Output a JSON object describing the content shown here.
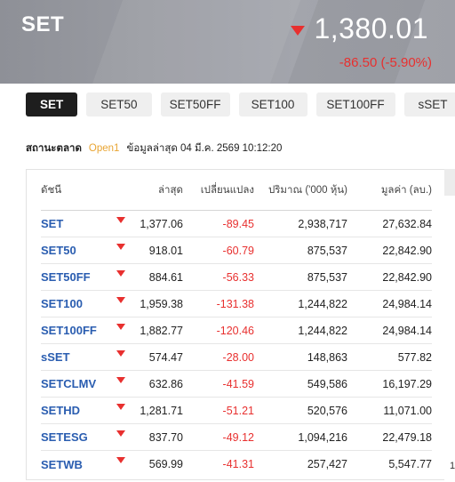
{
  "hero": {
    "title": "SET",
    "price": "1,380.01",
    "change": "-86.50 (-5.90%)",
    "direction_icon": "down-triangle-icon",
    "down_color": "#e8302f"
  },
  "tabs": [
    {
      "label": "SET",
      "active": true
    },
    {
      "label": "SET50",
      "active": false
    },
    {
      "label": "SET50FF",
      "active": false
    },
    {
      "label": "SET100",
      "active": false
    },
    {
      "label": "SET100FF",
      "active": false
    },
    {
      "label": "sSET",
      "active": false
    }
  ],
  "status": {
    "label": "สถานะตลาด",
    "market_state": "Open1",
    "updated": "ข้อมูลล่าสุด 04 มี.ค. 2569 10:12:20"
  },
  "table": {
    "headers": {
      "name": "ดัชนี",
      "last": "ล่าสุด",
      "change": "เปลี่ยนแปลง",
      "volume": "ปริมาณ ('000 หุ้น)",
      "value": "มูลค่า (ลบ.)"
    },
    "rows": [
      {
        "name": "SET",
        "last": "1,377.06",
        "change": "-89.45",
        "volume": "2,938,717",
        "value": "27,632.84"
      },
      {
        "name": "SET50",
        "last": "918.01",
        "change": "-60.79",
        "volume": "875,537",
        "value": "22,842.90"
      },
      {
        "name": "SET50FF",
        "last": "884.61",
        "change": "-56.33",
        "volume": "875,537",
        "value": "22,842.90"
      },
      {
        "name": "SET100",
        "last": "1,959.38",
        "change": "-131.38",
        "volume": "1,244,822",
        "value": "24,984.14"
      },
      {
        "name": "SET100FF",
        "last": "1,882.77",
        "change": "-120.46",
        "volume": "1,244,822",
        "value": "24,984.14"
      },
      {
        "name": "sSET",
        "last": "574.47",
        "change": "-28.00",
        "volume": "148,863",
        "value": "577.82"
      },
      {
        "name": "SETCLMV",
        "last": "632.86",
        "change": "-41.59",
        "volume": "549,586",
        "value": "16,197.29"
      },
      {
        "name": "SETHD",
        "last": "1,281.71",
        "change": "-51.21",
        "volume": "520,576",
        "value": "11,071.00"
      },
      {
        "name": "SETESG",
        "last": "837.70",
        "change": "-49.12",
        "volume": "1,094,216",
        "value": "22,479.18"
      },
      {
        "name": "SETWB",
        "last": "569.99",
        "change": "-41.31",
        "volume": "257,427",
        "value": "5,547.77"
      }
    ]
  },
  "side_mark": "1"
}
